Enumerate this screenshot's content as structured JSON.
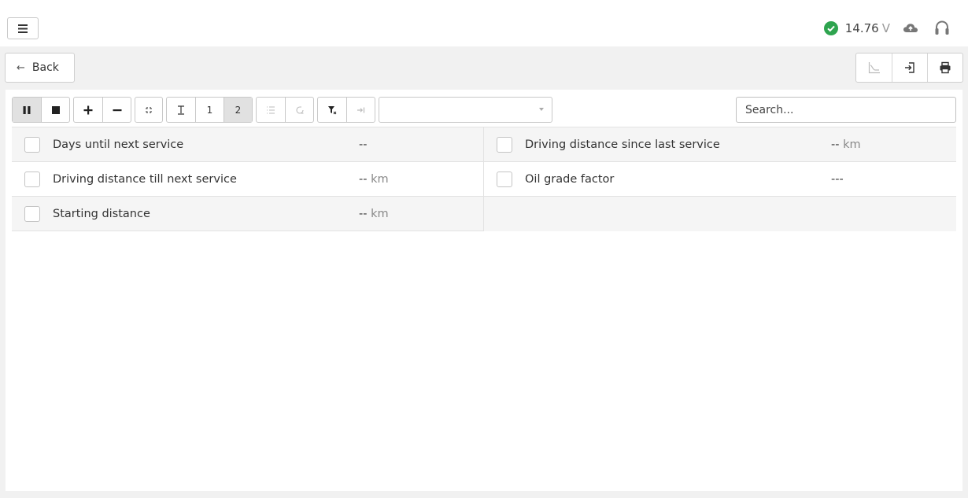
{
  "topbar": {
    "voltage_value": "14.76",
    "voltage_unit": "V",
    "status_color": "#2ea44f"
  },
  "navbar": {
    "back_label": "Back"
  },
  "toolbar": {
    "page_1": "1",
    "page_2": "2",
    "dropdown_value": ""
  },
  "search": {
    "placeholder": "Search..."
  },
  "rows": [
    {
      "left": {
        "label": "Days until next service",
        "value": "--",
        "unit": ""
      },
      "right": {
        "label": "Driving distance since last service",
        "value": "--",
        "unit": "km"
      }
    },
    {
      "left": {
        "label": "Driving distance till next service",
        "value": "--",
        "unit": "km"
      },
      "right": {
        "label": "Oil grade factor",
        "value": "---",
        "unit": ""
      }
    },
    {
      "left": {
        "label": "Starting distance",
        "value": "--",
        "unit": "km"
      }
    }
  ]
}
